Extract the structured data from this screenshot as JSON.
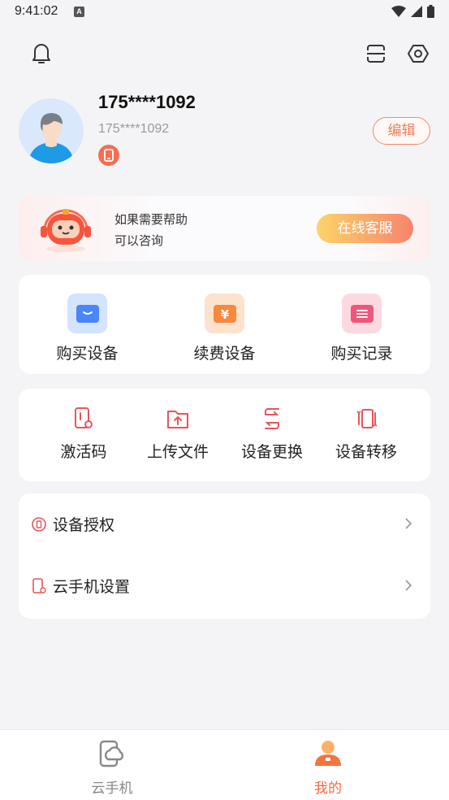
{
  "status_bar": {
    "time": "9:41:02",
    "notif_letter": "A"
  },
  "header": {
    "bell_icon": "bell-icon",
    "scan_icon": "scan-icon",
    "settings_icon": "gear-icon"
  },
  "profile": {
    "phone_main": "175****1092",
    "phone_sub": "175****1092",
    "edit_label": "编辑"
  },
  "banner": {
    "line1": "如果需要帮助",
    "line2": "可以咨询",
    "button_label": "在线客服"
  },
  "quick_actions": [
    {
      "label": "购买设备",
      "icon": "shopping-bag-icon",
      "color": "#4a86f7"
    },
    {
      "label": "续费设备",
      "icon": "yuan-icon",
      "color": "#f8883e"
    },
    {
      "label": "购买记录",
      "icon": "list-icon",
      "color": "#f0567a"
    }
  ],
  "tools": [
    {
      "label": "激活码",
      "icon": "activation-code-icon"
    },
    {
      "label": "上传文件",
      "icon": "upload-folder-icon"
    },
    {
      "label": "设备更换",
      "icon": "swap-device-icon"
    },
    {
      "label": "设备转移",
      "icon": "transfer-device-icon"
    }
  ],
  "menu": [
    {
      "label": "设备授权",
      "icon": "authorize-icon"
    },
    {
      "label": "云手机设置",
      "icon": "phone-settings-icon"
    }
  ],
  "tabbar": {
    "tabs": [
      {
        "label": "云手机",
        "active": false
      },
      {
        "label": "我的",
        "active": true
      }
    ]
  },
  "colors": {
    "accent": "#f36f4f",
    "tab_active": "#f36a3e",
    "tab_inactive": "#888888",
    "tool_icon": "#e7555a"
  }
}
